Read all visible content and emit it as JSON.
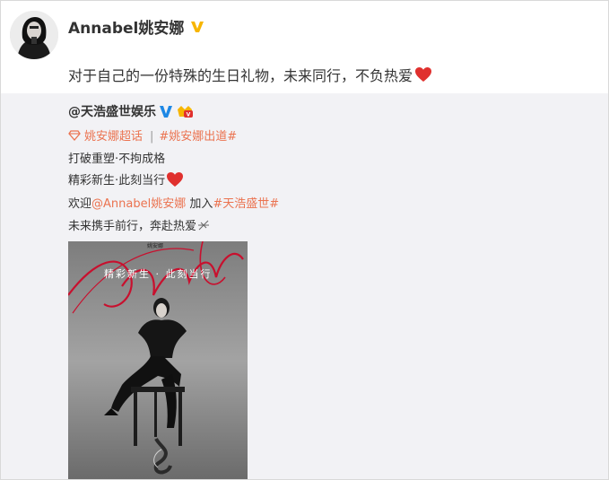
{
  "post": {
    "author": "Annabel姚安娜",
    "text": "对于自己的一份特殊的生日礼物，未来同行，不负热爱",
    "icons": {
      "avatar": "portrait-avatar",
      "verified": "verified-yellow-v-icon",
      "heart": "red-heart-emoji"
    }
  },
  "repost": {
    "author": "@天浩盛世娱乐",
    "supertopic": "姚安娜超话",
    "hashtag_debut": "#姚安娜出道#",
    "line_break": "打破重塑·不拘成格",
    "line_new": "精彩新生·此刻当行",
    "welcome_prefix": "欢迎",
    "welcome_mention": "@Annabel姚安娜",
    "welcome_join": " 加入",
    "welcome_hashtag": "#天浩盛世#",
    "line_future": "未来携手前行，奔赴热爱",
    "poster_slogan": "精彩新生 · 此刻当行",
    "poster_top": "姚安娜",
    "icons": {
      "verified": "verified-blue-v-icon",
      "badge": "member-badge-icon",
      "supertopic": "diamond-supertopic-icon",
      "poster": "annabel-poster-image"
    }
  },
  "colors": {
    "link": "#eb7350",
    "repost_bg": "#f2f2f5",
    "heart": "#e0302e",
    "verified_yellow": "#f7b500",
    "verified_blue": "#1e88e5"
  }
}
